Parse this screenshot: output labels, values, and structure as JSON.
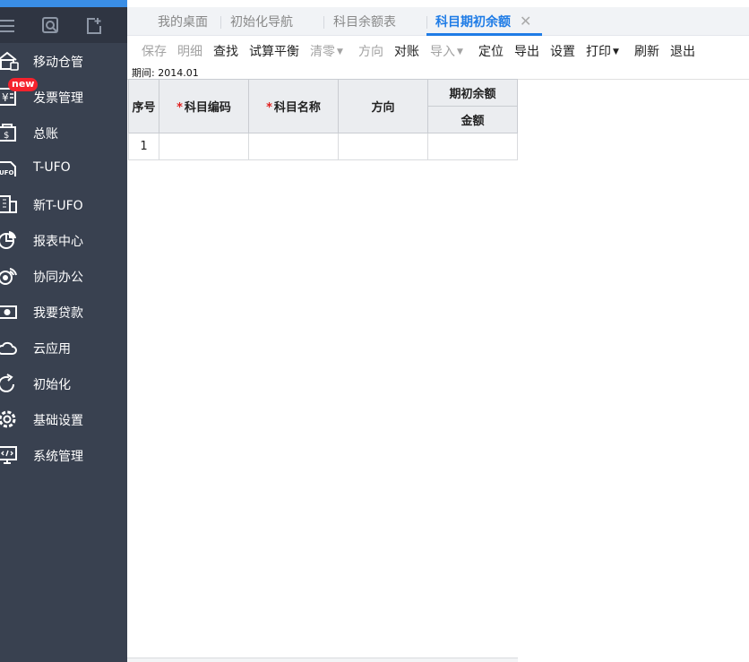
{
  "sidebar": {
    "items": [
      {
        "id": "mobile-warehouse",
        "label": "移动仓管",
        "icon": "warehouse-icon"
      },
      {
        "id": "invoice",
        "label": "发票管理",
        "icon": "invoice-icon",
        "badge": "new"
      },
      {
        "id": "ledger",
        "label": "总账",
        "icon": "ledger-icon"
      },
      {
        "id": "tufo",
        "label": "T-UFO",
        "icon": "ufo-icon"
      },
      {
        "id": "new-tufo",
        "label": "新T-UFO",
        "icon": "building-icon"
      },
      {
        "id": "reports",
        "label": "报表中心",
        "icon": "pie-chart-icon"
      },
      {
        "id": "collab",
        "label": "协同办公",
        "icon": "signal-icon"
      },
      {
        "id": "loan",
        "label": "我要贷款",
        "icon": "cash-icon"
      },
      {
        "id": "cloud",
        "label": "云应用",
        "icon": "cloud-icon"
      },
      {
        "id": "init",
        "label": "初始化",
        "icon": "refresh-icon"
      },
      {
        "id": "basic",
        "label": "基础设置",
        "icon": "gear-icon"
      },
      {
        "id": "system",
        "label": "系统管理",
        "icon": "monitor-code-icon"
      }
    ]
  },
  "tabs": [
    {
      "label": "我的桌面",
      "active": false
    },
    {
      "label": "初始化导航",
      "active": false
    },
    {
      "label": "科目余额表",
      "active": false
    },
    {
      "label": "科目期初余额",
      "active": true
    }
  ],
  "toolbar": {
    "save": "保存",
    "detail": "明细",
    "find": "查找",
    "trial": "试算平衡",
    "clear": "清零",
    "direction": "方向",
    "reconcile": "对账",
    "import": "导入",
    "locate": "定位",
    "export": "导出",
    "settings": "设置",
    "print": "打印",
    "refresh": "刷新",
    "exit": "退出"
  },
  "period": {
    "text": "期间: 2014.01"
  },
  "grid": {
    "headers": {
      "seq": "序号",
      "code": "科目编码",
      "name": "科目名称",
      "direction": "方向",
      "opening": "期初余额",
      "amount": "金额"
    },
    "rows": [
      {
        "seq": "1",
        "code": "",
        "name": "",
        "direction": "",
        "amount": ""
      }
    ]
  },
  "colors": {
    "accent": "#1f7ce6",
    "sidebar": "#394150",
    "required": "#e02020"
  }
}
